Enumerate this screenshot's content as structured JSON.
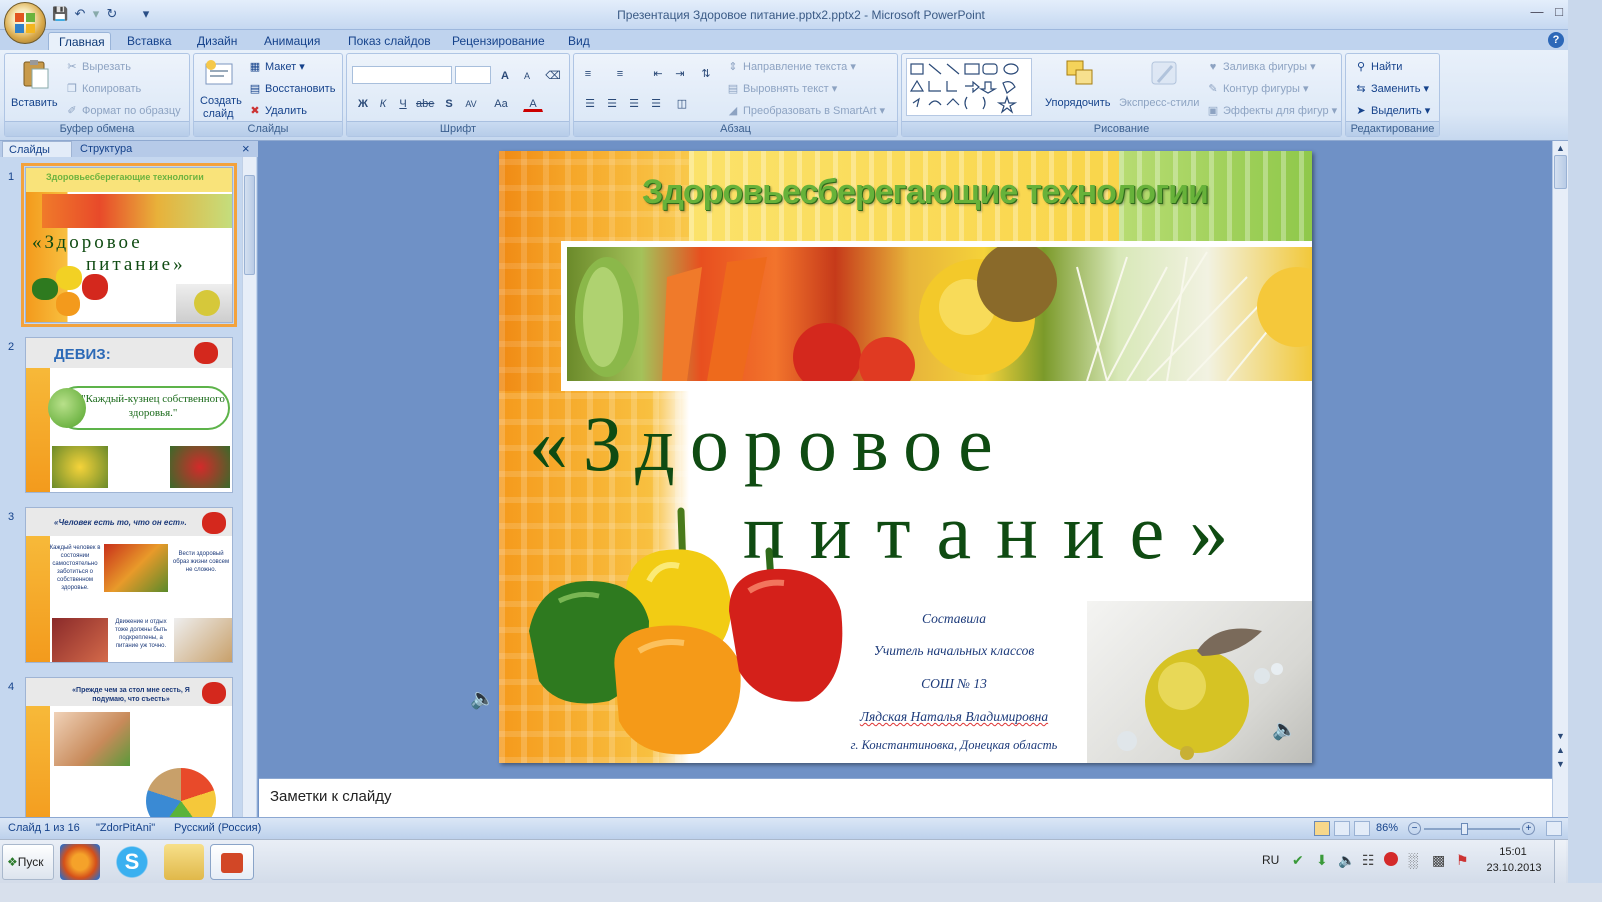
{
  "window": {
    "title": "Презентация Здоровое питание.pptx2.pptx2 - Microsoft PowerPoint",
    "help_icon": "?"
  },
  "tabs": [
    "Главная",
    "Вставка",
    "Дизайн",
    "Анимация",
    "Показ слайдов",
    "Рецензирование",
    "Вид"
  ],
  "ribbon": {
    "clipboard": {
      "label": "Буфер обмена",
      "paste": "Вставить",
      "cut": "Вырезать",
      "copy": "Копировать",
      "format_painter": "Формат по образцу"
    },
    "slides": {
      "label": "Слайды",
      "create": "Создать",
      "create2": "слайд",
      "layout": "Макет",
      "reset": "Восстановить",
      "delete": "Удалить"
    },
    "font": {
      "label": "Шрифт",
      "bold": "Ж",
      "italic": "К",
      "underline": "Ч",
      "strike": "abe",
      "shadow": "S",
      "spacing": "AV",
      "case": "Aa",
      "color": "A",
      "grow": "A",
      "shrink": "A"
    },
    "paragraph": {
      "label": "Абзац",
      "text_direction": "Направление текста",
      "align_text": "Выровнять текст",
      "smartart": "Преобразовать в SmartArt"
    },
    "drawing": {
      "label": "Рисование",
      "arrange": "Упорядочить",
      "quick_styles": "Экспресс-стили",
      "fill": "Заливка фигуры",
      "outline": "Контур фигуры",
      "effects": "Эффекты для фигур"
    },
    "editing": {
      "label": "Редактирование",
      "find": "Найти",
      "replace": "Заменить",
      "select": "Выделить"
    }
  },
  "panel": {
    "tab_slides": "Слайды",
    "tab_outline": "Структура",
    "close": "×"
  },
  "thumbnails": [
    {
      "num": "1",
      "title": "Здоровьесберегающие технологии",
      "line1": "«Здоровое",
      "line2": "питание»"
    },
    {
      "num": "2",
      "title": "ДЕВИЗ:",
      "quote": "\"Каждый-кузнец собственного здоровья.\""
    },
    {
      "num": "3",
      "title": "«Человек есть то, что он ест».",
      "t1": "Каждый человек в состоянии самостоятельно заботиться о собственном здоровье.",
      "t2": "Вести здоровый образ жизни совсем не сложно.",
      "t3": "Движение и отдых тоже должны быть подкреплены, а питание уж точно."
    },
    {
      "num": "4",
      "title": "«Прежде чем за стол мне сесть, Я подумаю, что съесть»"
    }
  ],
  "slide": {
    "header": "Здоровьесберегающие технологии",
    "title_line1": "«Здоровое",
    "title_line2": "питание»",
    "credits": [
      "Составила",
      "Учитель начальных классов",
      "СОШ № 13",
      "Лядская Наталья Владимировна",
      "г. Константиновка, Донецкая область"
    ]
  },
  "notes_placeholder": "Заметки к слайду",
  "status": {
    "slide": "Слайд 1 из 16",
    "theme": "\"ZdorPitAni\"",
    "language": "Русский (Россия)",
    "zoom": "86%"
  },
  "taskbar": {
    "start": "Пуск",
    "lang": "RU",
    "time": "15:01",
    "date": "23.10.2013"
  },
  "colors": {
    "accent_green": "#0f4b12",
    "ribbon_blue": "#15428b",
    "header_green": "#6db33f"
  }
}
